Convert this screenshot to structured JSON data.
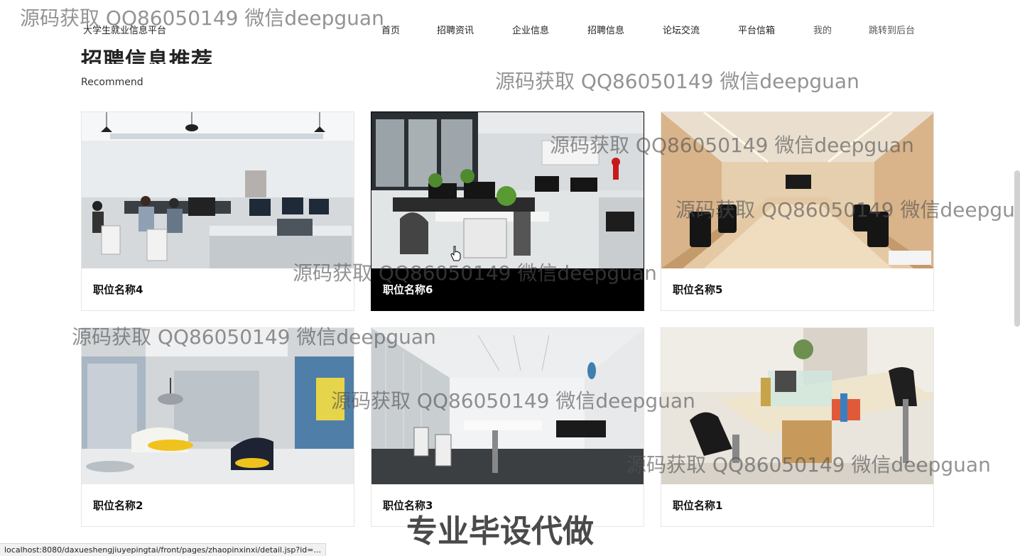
{
  "header": {
    "brand": "大学生就业信息平台",
    "nav": [
      {
        "label": "首页"
      },
      {
        "label": "招聘资讯"
      },
      {
        "label": "企业信息"
      },
      {
        "label": "招聘信息"
      },
      {
        "label": "论坛交流"
      },
      {
        "label": "平台信箱"
      },
      {
        "label": "我的"
      },
      {
        "label": "跳转到后台"
      }
    ]
  },
  "section": {
    "title": "招聘信息推荐",
    "subtitle": "Recommend"
  },
  "cards": [
    {
      "title": "职位名称4",
      "image": "office-workstations"
    },
    {
      "title": "职位名称6",
      "image": "modern-office-desks"
    },
    {
      "title": "职位名称5",
      "image": "conference-room"
    },
    {
      "title": "职位名称2",
      "image": "creative-lounge"
    },
    {
      "title": "职位名称3",
      "image": "open-plan-office"
    },
    {
      "title": "职位名称1",
      "image": "desk-cluster"
    }
  ],
  "watermarks": [
    "源码获取 QQ86050149 微信deepguan",
    "源码获取 QQ86050149 微信deepguan",
    "源码获取 QQ86050149 微信deepguan",
    "源码获取 QQ86050149 微信deepgu",
    "源码获取 QQ86050149 微信deepguan",
    "源码获取 QQ86050149 微信deepguan",
    "源码获取 QQ86050149 微信deepguan",
    "源码获取 QQ86050149 微信deepguan"
  ],
  "promo_overlay": "专业毕设代做",
  "status_url": "localhost:8080/daxueshengjiuyepingtai/front/pages/zhaopinxinxi/detail.jsp?id=...",
  "colors": {
    "active_caption_bg": "#000000",
    "card_border": "#e6e6e6"
  }
}
